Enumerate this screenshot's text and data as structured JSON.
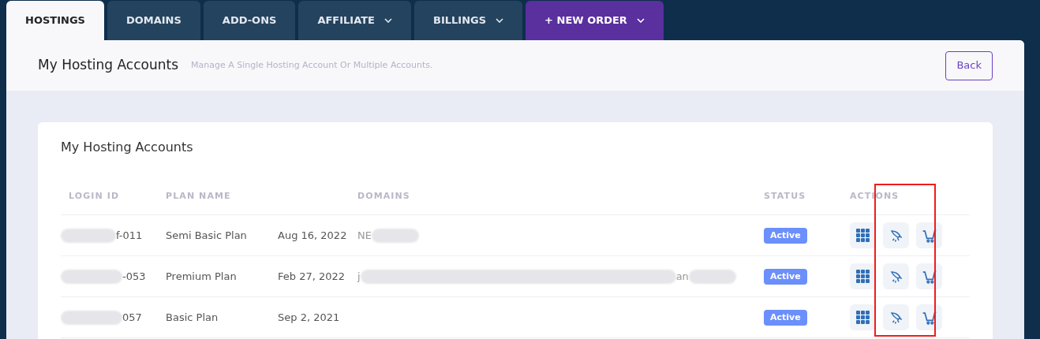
{
  "tabs": [
    {
      "label": "HOSTINGS",
      "selected": true,
      "kind": "plain",
      "dropdown": false
    },
    {
      "label": "DOMAINS",
      "selected": false,
      "kind": "plain",
      "dropdown": false
    },
    {
      "label": "ADD-ONS",
      "selected": false,
      "kind": "plain",
      "dropdown": false
    },
    {
      "label": "AFFILIATE",
      "selected": false,
      "kind": "plain",
      "dropdown": true
    },
    {
      "label": "BILLINGS",
      "selected": false,
      "kind": "plain",
      "dropdown": true
    },
    {
      "label": "+ NEW ORDER",
      "selected": false,
      "kind": "accent",
      "dropdown": true
    }
  ],
  "header": {
    "title": "My Hosting Accounts",
    "subtitle": "Manage A Single Hosting Account Or Multiple Accounts.",
    "back_button": "Back"
  },
  "card": {
    "title": "My Hosting Accounts",
    "table": {
      "columns": [
        "LOGIN ID",
        "PLAN NAME",
        "DOMAINS",
        "STATUS",
        "ACTIONS"
      ],
      "rows": [
        {
          "login_id": "f-011",
          "plan": "Semi Basic Plan",
          "date": "Aug 16, 2022",
          "domain_parts": [
            "NE"
          ],
          "status": "Active"
        },
        {
          "login_id": "-053",
          "plan": "Premium Plan",
          "date": "Feb 27, 2022",
          "domain_parts": [
            "j",
            "an"
          ],
          "status": "Active"
        },
        {
          "login_id": "057",
          "plan": "Basic Plan",
          "date": "Sep 2, 2021",
          "domain_parts": [],
          "status": "Active"
        }
      ]
    }
  },
  "annotation": {
    "kind": "highlight"
  }
}
